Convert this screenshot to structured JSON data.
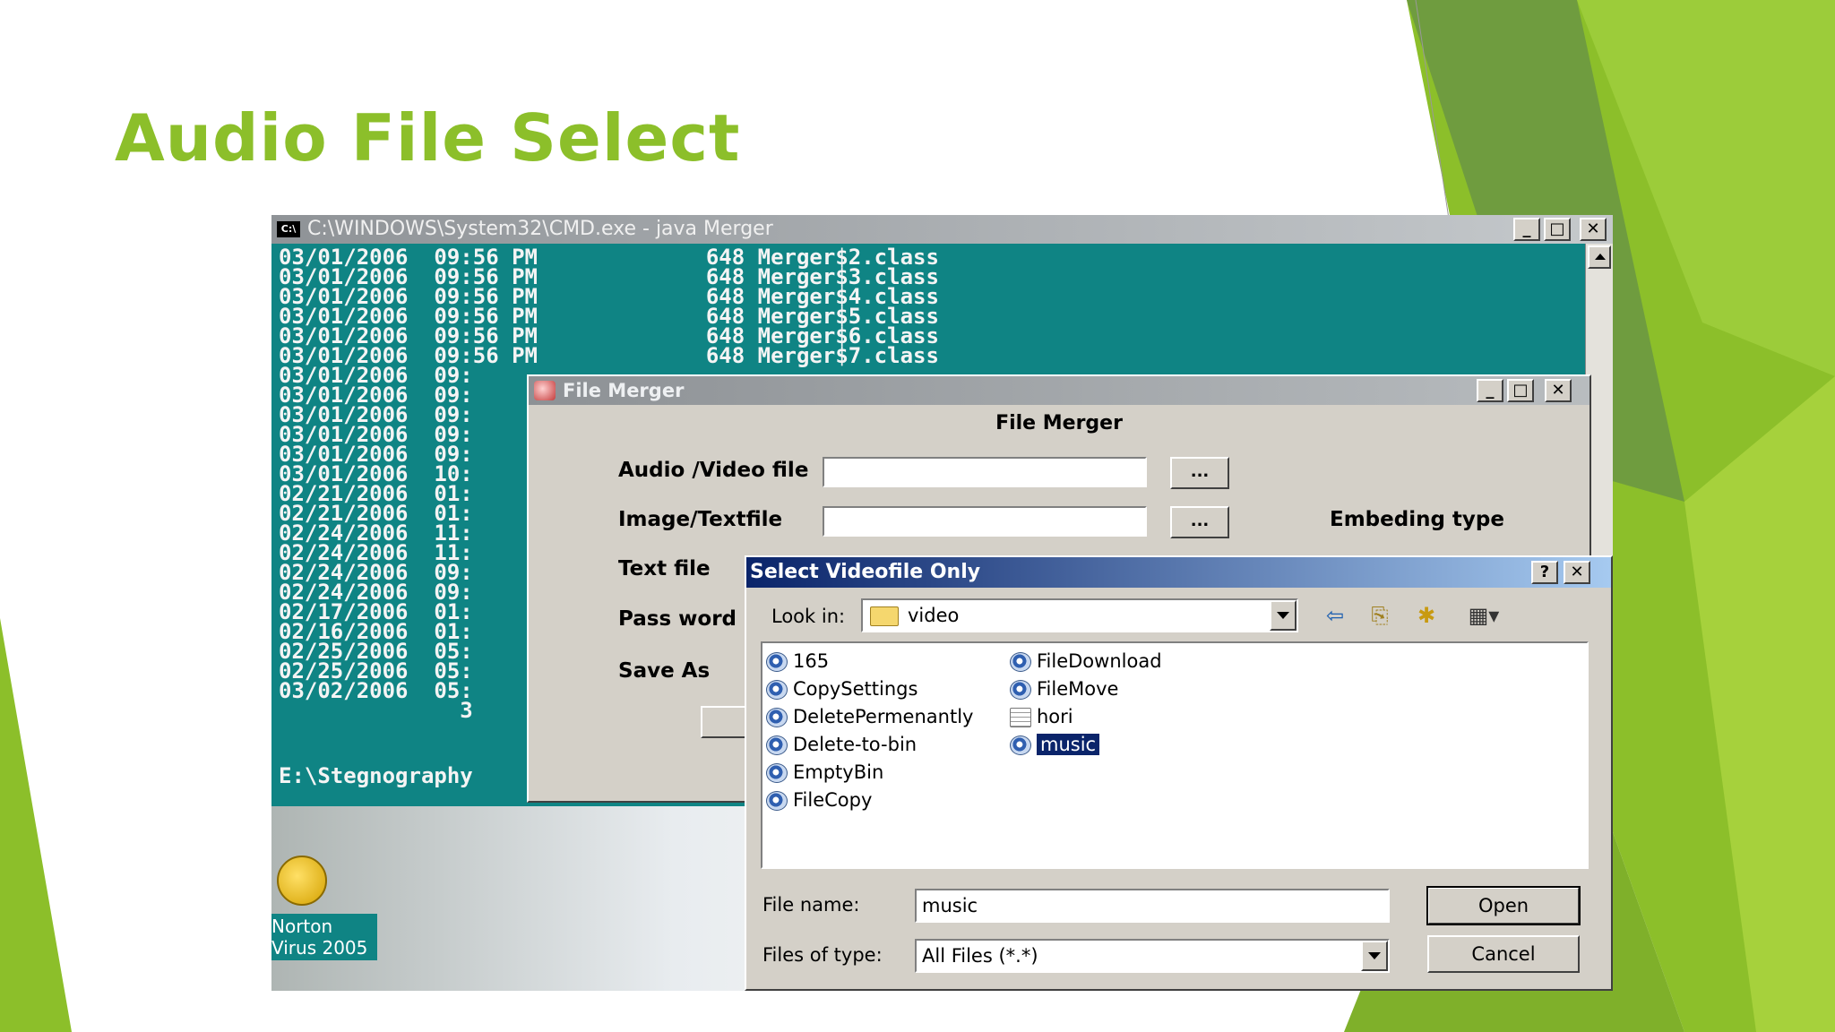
{
  "slide": {
    "title": "Audio File Select"
  },
  "colors": {
    "accent_green": "#8cbf2a",
    "console_teal": "#0f8484",
    "dialog_title_blue": "#0a246a"
  },
  "cmd_window": {
    "title": "C:\\WINDOWS\\System32\\CMD.exe - java Merger",
    "icon": "console-icon",
    "lines": [
      "03/01/2006  09:56 PM             648 Merger$2.class",
      "03/01/2006  09:56 PM             648 Merger$3.class",
      "03/01/2006  09:56 PM             648 Merger$4.class",
      "03/01/2006  09:56 PM             648 Merger$5.class",
      "03/01/2006  09:56 PM             648 Merger$6.class",
      "03/01/2006  09:56 PM             648 Merger$7.class",
      "03/01/2006  09:",
      "03/01/2006  09:",
      "03/01/2006  09:",
      "03/01/2006  09:",
      "03/01/2006  09:",
      "03/01/2006  10:",
      "02/21/2006  01:",
      "02/21/2006  01:",
      "02/24/2006  11:",
      "02/24/2006  11:",
      "02/24/2006  09:",
      "02/24/2006  09:",
      "02/17/2006  01:",
      "02/16/2006  01:",
      "02/25/2006  05:",
      "02/25/2006  05:",
      "03/02/2006  05:",
      "              3"
    ],
    "prompt": "E:\\Stegnography"
  },
  "merger_window": {
    "title": "File Merger",
    "heading": "File Merger",
    "labels": {
      "audio_video": "Audio /Video file",
      "image_text": "Image/Textfile",
      "text_file": "Text file",
      "password": "Pass word",
      "save_as": "Save As",
      "embeding_type": "Embeding type"
    },
    "browse_label": "...",
    "audio_video_value": "",
    "image_text_value": ""
  },
  "select_dialog": {
    "title": "Select Videofile Only",
    "help_label": "?",
    "close_label": "✕",
    "look_in_label": "Look in:",
    "look_in_value": "video",
    "files_col1": [
      "165",
      "CopySettings",
      "DeletePermenantly",
      "Delete-to-bin",
      "EmptyBin",
      "FileCopy"
    ],
    "files_col2": [
      "FileDownload",
      "FileMove",
      "hori",
      "music"
    ],
    "selected_file": "music",
    "file_name_label": "File name:",
    "file_name_value": "music",
    "files_of_type_label": "Files of type:",
    "files_of_type_value": "All Files (*.*)",
    "open_label": "Open",
    "cancel_label": "Cancel",
    "toolbar_icons": [
      "back-arrow-icon",
      "up-folder-icon",
      "new-folder-icon",
      "view-menu-icon"
    ]
  },
  "desktop": {
    "icon_label_line1": "Norton",
    "icon_label_line2": "Virus 2005"
  },
  "window_buttons": {
    "minimize": "_",
    "maximize": "□",
    "close": "✕"
  }
}
